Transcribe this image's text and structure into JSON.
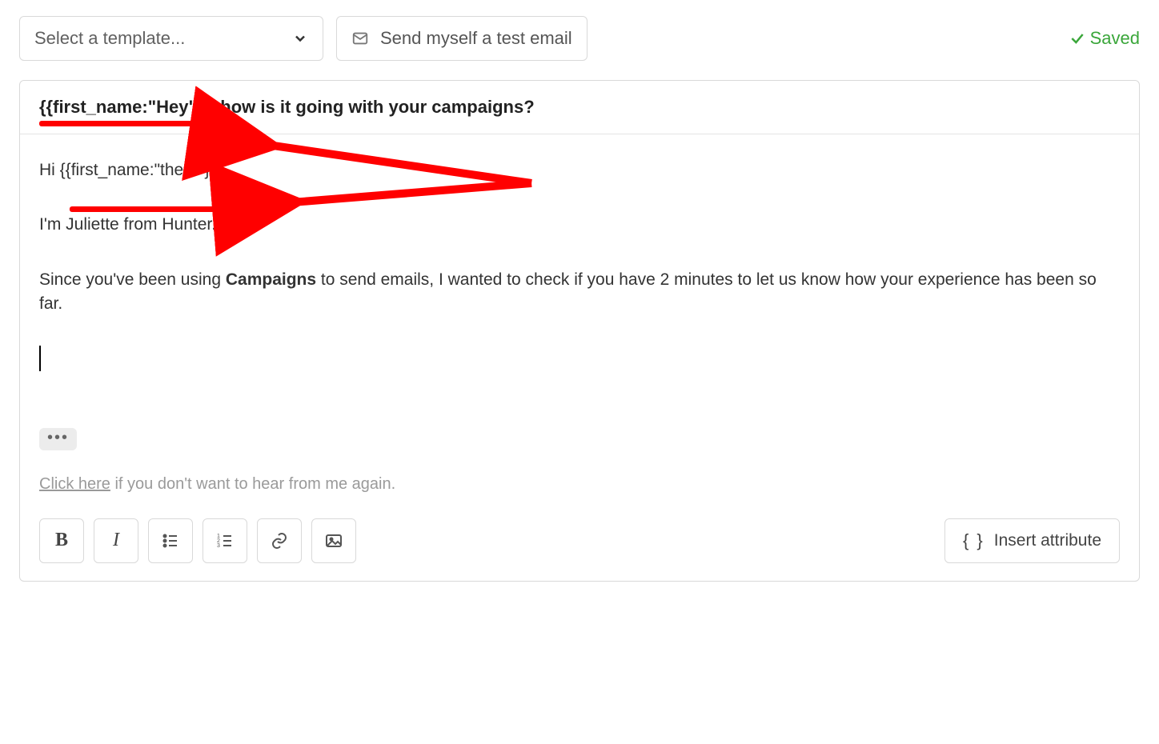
{
  "toolbar": {
    "template_placeholder": "Select a template...",
    "test_email_label": "Send myself a test email",
    "saved_label": "Saved"
  },
  "subject": {
    "token": "{{first_name:\"Hey\"}}",
    "rest": ", how is it going with your campaigns?"
  },
  "body": {
    "greeting_prefix": "Hi ",
    "greeting_token": "{{first_name:\"there\"}}",
    "greeting_suffix": ",",
    "intro": "I'm Juliette from Hunter.",
    "p2_a": "Since you've been using ",
    "p2_bold": "Campaigns",
    "p2_b": " to send emails, I wanted to check if you have 2 minutes to let us know how your experience has been so far.",
    "ellipsis": "•••",
    "unsub_link": "Click here",
    "unsub_rest": " if you don't want to hear from me again."
  },
  "footer_toolbar": {
    "insert_attr": "Insert attribute"
  },
  "annotation": {
    "color": "#ff0000"
  }
}
